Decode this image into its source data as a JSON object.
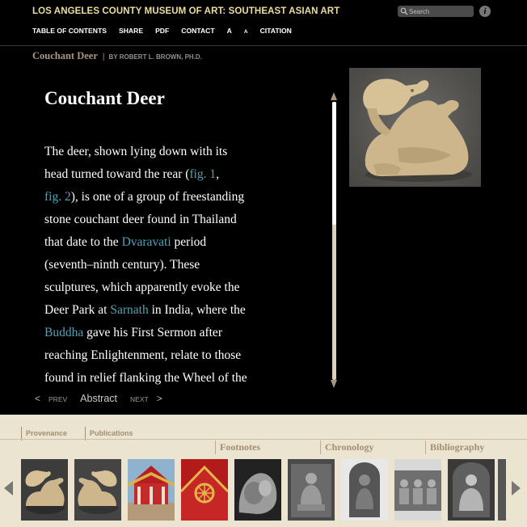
{
  "header": {
    "site_title": "LOS ANGELES COUNTY MUSEUM OF ART: SOUTHEAST ASIAN ART",
    "search_placeholder": "Search",
    "info_icon": "info-icon",
    "nav": [
      "TABLE OF CONTENTS",
      "SHARE",
      "PDF",
      "CONTACT",
      "A",
      "A",
      "CITATION"
    ]
  },
  "breadcrumb": {
    "title": "Couchant Deer",
    "separator": "|",
    "author": "BY ROBERT L. BROWN, PH.D."
  },
  "article": {
    "title": "Couchant Deer",
    "lines": [
      [
        {
          "t": "The deer, shown lying down with its"
        }
      ],
      [
        {
          "t": "head turned toward the rear ("
        },
        {
          "t": "fig. 1",
          "link": true
        },
        {
          "t": ","
        }
      ],
      [
        {
          "t": "fig. 2",
          "link": true
        },
        {
          "t": "), is one of a group of freestanding"
        }
      ],
      [
        {
          "t": "stone couchant deer found in Thailand"
        }
      ],
      [
        {
          "t": "that date to the "
        },
        {
          "t": "Dvaravati",
          "link": true
        },
        {
          "t": " period"
        }
      ],
      [
        {
          "t": "(seventh–ninth century). These"
        }
      ],
      [
        {
          "t": "sculptures, which apparently evoke the"
        }
      ],
      [
        {
          "t": "Deer Park at "
        },
        {
          "t": "Sarnath",
          "link": true
        },
        {
          "t": " in India, where the"
        }
      ],
      [
        {
          "t": "Buddha",
          "link": true
        },
        {
          "t": " gave his First Sermon after"
        }
      ],
      [
        {
          "t": "reaching Enlightenment, relate to those"
        }
      ],
      [
        {
          "t": "found in relief flanking the Wheel of the"
        }
      ]
    ]
  },
  "pager": {
    "prev_arrow": "<",
    "prev_label": "PREV",
    "current": "Abstract",
    "next_label": "NEXT",
    "next_arrow": ">"
  },
  "bottom": {
    "top_tabs": [
      "Provenance",
      "Publications"
    ],
    "sub_tabs": [
      "Footnotes",
      "Chronology",
      "Bibliography"
    ],
    "thumbnails": [
      "deer-sculpture-thumbnail",
      "deer-sculpture-thumbnail",
      "red-temple-thumbnail",
      "dharma-wheel-thumbnail",
      "stone-relief-thumbnail",
      "seated-buddha-relief-thumbnail",
      "buddha-stele-thumbnail",
      "frieze-relief-thumbnail",
      "cave-buddha-thumbnail",
      "partial-thumbnail"
    ]
  },
  "colors": {
    "site_title": "#ecdf9c",
    "link": "#4fa3b6",
    "tab_text": "#a58e6f",
    "panel_bg": "#ebe4d0"
  }
}
